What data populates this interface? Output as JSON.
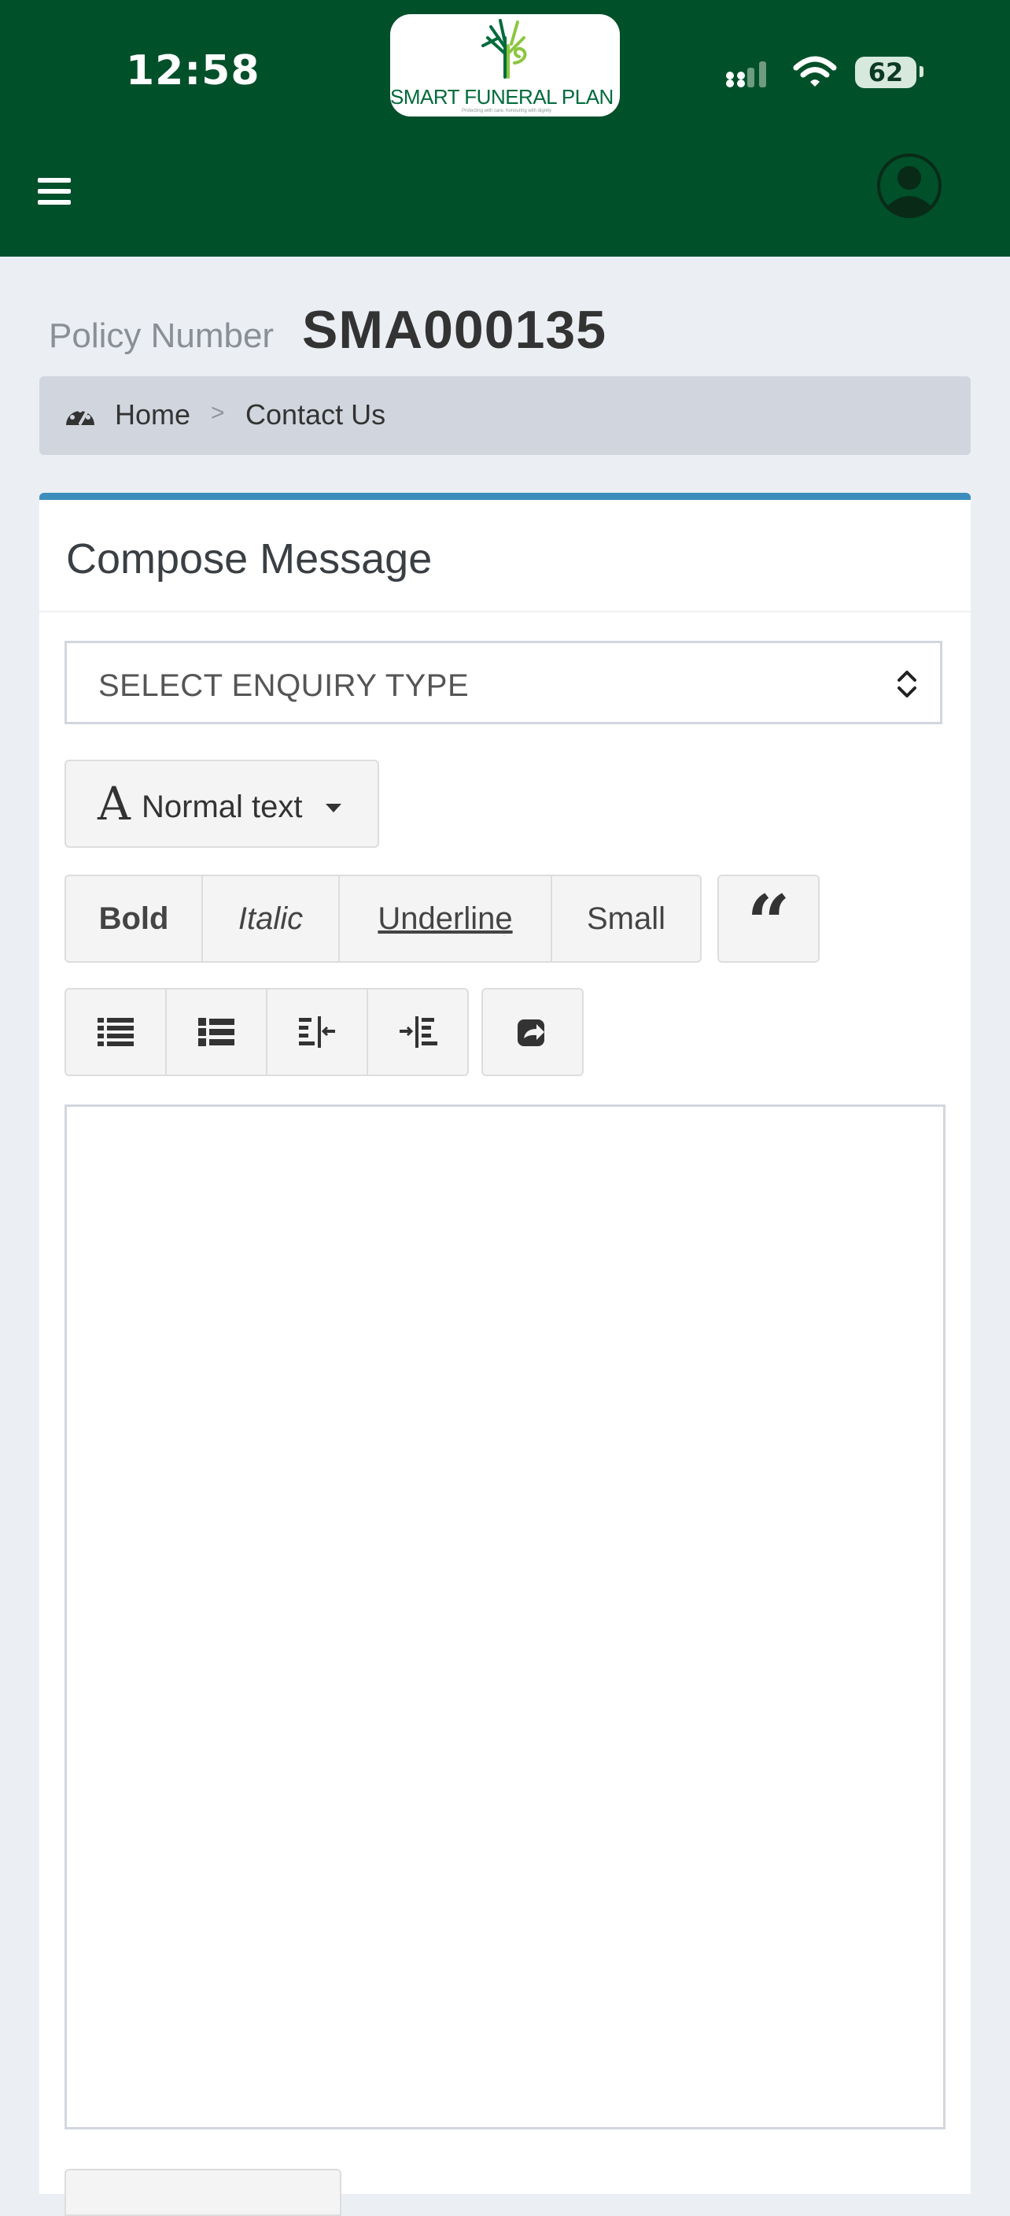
{
  "status_bar": {
    "time": "12:58",
    "battery": "62"
  },
  "header": {
    "logo_text": "SMART FUNERAL PLAN",
    "logo_tagline": "Protecting with care, honouring with dignity",
    "colors": {
      "background": "#00502a",
      "accent": "#3c8dbc"
    }
  },
  "policy": {
    "label": "Policy Number",
    "number": "SMA000135"
  },
  "breadcrumb": {
    "home": "Home",
    "separator": ">",
    "current": "Contact Us"
  },
  "compose": {
    "title": "Compose Message",
    "enquiry_select": {
      "selected": "SELECT ENQUIRY TYPE"
    },
    "toolbar": {
      "font_icon": "A",
      "normal_text": "Normal text",
      "bold": "Bold",
      "italic": "Italic",
      "underline": "Underline",
      "small": "Small",
      "quote_icon": "“",
      "icons": [
        "list-ul-icon",
        "list-ol-icon",
        "outdent-icon",
        "indent-icon",
        "share-icon"
      ]
    },
    "message_body": ""
  }
}
